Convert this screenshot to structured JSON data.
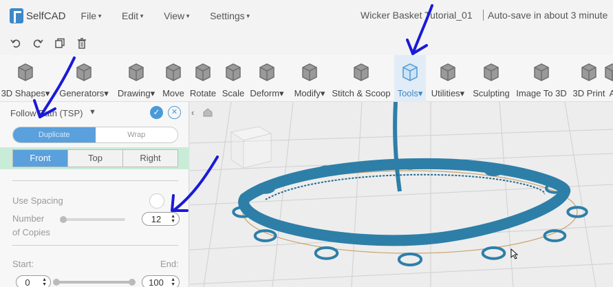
{
  "app": {
    "logo_text": "SelfCAD",
    "document_title": "Wicker Basket Tutorial_01",
    "autosave_text": "Auto-save in about 3 minute"
  },
  "menu": {
    "file": "File",
    "edit": "Edit",
    "view": "View",
    "settings": "Settings"
  },
  "quick_actions": {
    "undo": "undo-icon",
    "redo": "redo-icon",
    "copy": "copy-icon",
    "delete": "trash-icon"
  },
  "toolbar": {
    "tools": [
      {
        "label": "3D Shapes",
        "caret": true,
        "icon": "cube-icon"
      },
      {
        "label": "Generators",
        "caret": true,
        "icon": "generator-icon"
      },
      {
        "label": "Drawing",
        "caret": true,
        "icon": "drawing-icon"
      },
      {
        "label": "Move",
        "caret": false,
        "icon": "move-icon"
      },
      {
        "label": "Rotate",
        "caret": false,
        "icon": "rotate-icon"
      },
      {
        "label": "Scale",
        "caret": false,
        "icon": "scale-icon"
      },
      {
        "label": "Deform",
        "caret": true,
        "icon": "deform-icon"
      },
      {
        "label": "Modify",
        "caret": true,
        "icon": "modify-icon"
      },
      {
        "label": "Stitch & Scoop",
        "caret": false,
        "icon": "stitch-icon"
      },
      {
        "label": "Tools",
        "caret": true,
        "icon": "tools-icon",
        "active": true
      },
      {
        "label": "Utilities",
        "caret": true,
        "icon": "utilities-icon"
      },
      {
        "label": "Sculpting",
        "caret": false,
        "icon": "sculpting-icon"
      },
      {
        "label": "Image To 3D",
        "caret": false,
        "icon": "image-to-3d-icon"
      },
      {
        "label": "3D Print",
        "caret": false,
        "icon": "printer-icon"
      },
      {
        "label": "A",
        "caret": false,
        "icon": "more-icon"
      }
    ]
  },
  "panel": {
    "title": "Follow Path (TSP)",
    "title_caret": "▼",
    "confirm_icon": "✓",
    "close_icon": "✕",
    "mode_options": [
      "Duplicate",
      "Wrap"
    ],
    "mode_selected": "Duplicate",
    "views": [
      "Front",
      "Top",
      "Right"
    ],
    "view_selected": "Front",
    "use_spacing_label": "Use Spacing",
    "use_spacing_on": false,
    "copies_label_1": "Number",
    "copies_label_2": "of Copies",
    "copies_value": "12",
    "start_label": "Start:",
    "end_label": "End:",
    "start_value": "0",
    "end_value": "100"
  },
  "colors": {
    "accent": "#4a9ad8",
    "model": "#2d7fa8",
    "annotation": "#1a1ad8",
    "view_row": "#c9ecd9"
  }
}
